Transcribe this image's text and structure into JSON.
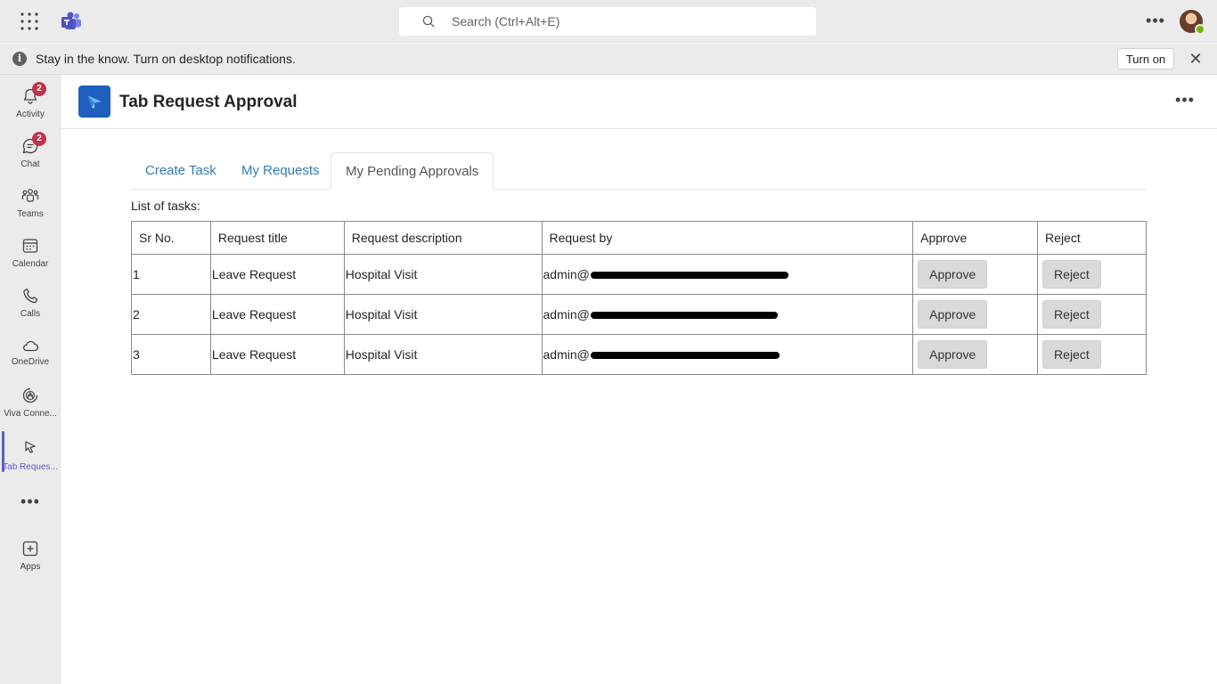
{
  "topbar": {
    "search_placeholder": "Search (Ctrl+Alt+E)",
    "more_label": "•••"
  },
  "banner": {
    "message": "Stay in the know. Turn on desktop notifications.",
    "turn_on_label": "Turn on",
    "close_label": "✕",
    "info_label": "i"
  },
  "rail": {
    "items": [
      {
        "label": "Activity",
        "badge": "2",
        "icon": "bell-icon"
      },
      {
        "label": "Chat",
        "badge": "2",
        "icon": "chat-icon"
      },
      {
        "label": "Teams",
        "icon": "teams-icon"
      },
      {
        "label": "Calendar",
        "icon": "calendar-icon"
      },
      {
        "label": "Calls",
        "icon": "phone-icon"
      },
      {
        "label": "OneDrive",
        "icon": "cloud-icon"
      },
      {
        "label": "Viva Conne...",
        "icon": "viva-connections-icon"
      },
      {
        "label": "Tab Reques...",
        "icon": "tab-request-icon",
        "active": true
      },
      {
        "label": "Apps",
        "icon": "add-apps-icon"
      }
    ],
    "more_label": "•••"
  },
  "app": {
    "title": "Tab Request Approval",
    "more_label": "•••",
    "tabs": [
      {
        "label": "Create Task"
      },
      {
        "label": "My Requests"
      },
      {
        "label": "My Pending Approvals",
        "active": true
      }
    ],
    "list_label": "List of tasks:",
    "table": {
      "headers": [
        "Sr No.",
        "Request title",
        "Request description",
        "Request by",
        "Approve",
        "Reject"
      ],
      "rows": [
        {
          "sr": "1",
          "title": "Leave Request",
          "description": "Hospital Visit",
          "by": "admin@",
          "approve": "Approve",
          "reject": "Reject"
        },
        {
          "sr": "2",
          "title": "Leave Request",
          "description": "Hospital Visit",
          "by": "admin@",
          "approve": "Approve",
          "reject": "Reject"
        },
        {
          "sr": "3",
          "title": "Leave Request",
          "description": "Hospital Visit",
          "by": "admin@",
          "approve": "Approve",
          "reject": "Reject"
        }
      ]
    }
  },
  "colors": {
    "accent": "#5b5fc7",
    "badge": "#c4314b",
    "link": "#337ab7",
    "app_icon": "#1f5fbd",
    "presence": "#6bb700"
  }
}
